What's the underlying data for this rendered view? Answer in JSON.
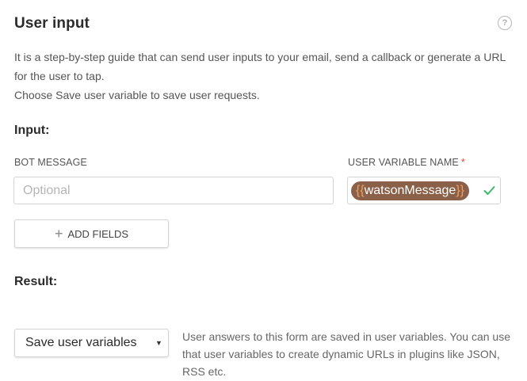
{
  "header": {
    "title": "User input",
    "help_icon": "question-circle-icon",
    "help_glyph": "?"
  },
  "description": {
    "line1": "It is a step-by-step guide that can send user inputs to your email, send a callback or generate a URL for the user to tap.",
    "line2": "Choose Save user variable to save user requests."
  },
  "input_section": {
    "title": "Input:",
    "bot_message": {
      "label": "BOT MESSAGE",
      "value": "",
      "placeholder": "Optional"
    },
    "user_variable": {
      "label": "USER VARIABLE NAME",
      "required_mark": "*",
      "open_brace": "{{",
      "variable_name": "watsonMessage",
      "close_brace": "}}",
      "status_icon": "check-icon",
      "chip_color": "#8b6049",
      "brace_color": "#f1a25a",
      "check_color": "#3fb768"
    },
    "add_fields": {
      "icon": "plus-icon",
      "icon_glyph": "+",
      "label": "ADD FIELDS"
    }
  },
  "result_section": {
    "title": "Result:",
    "select": {
      "selected": "Save user variables",
      "caret_glyph": "▼"
    },
    "note": "User answers to this form are saved in user variables. You can use that user variables to create dynamic URLs in plugins like JSON, RSS etc."
  }
}
